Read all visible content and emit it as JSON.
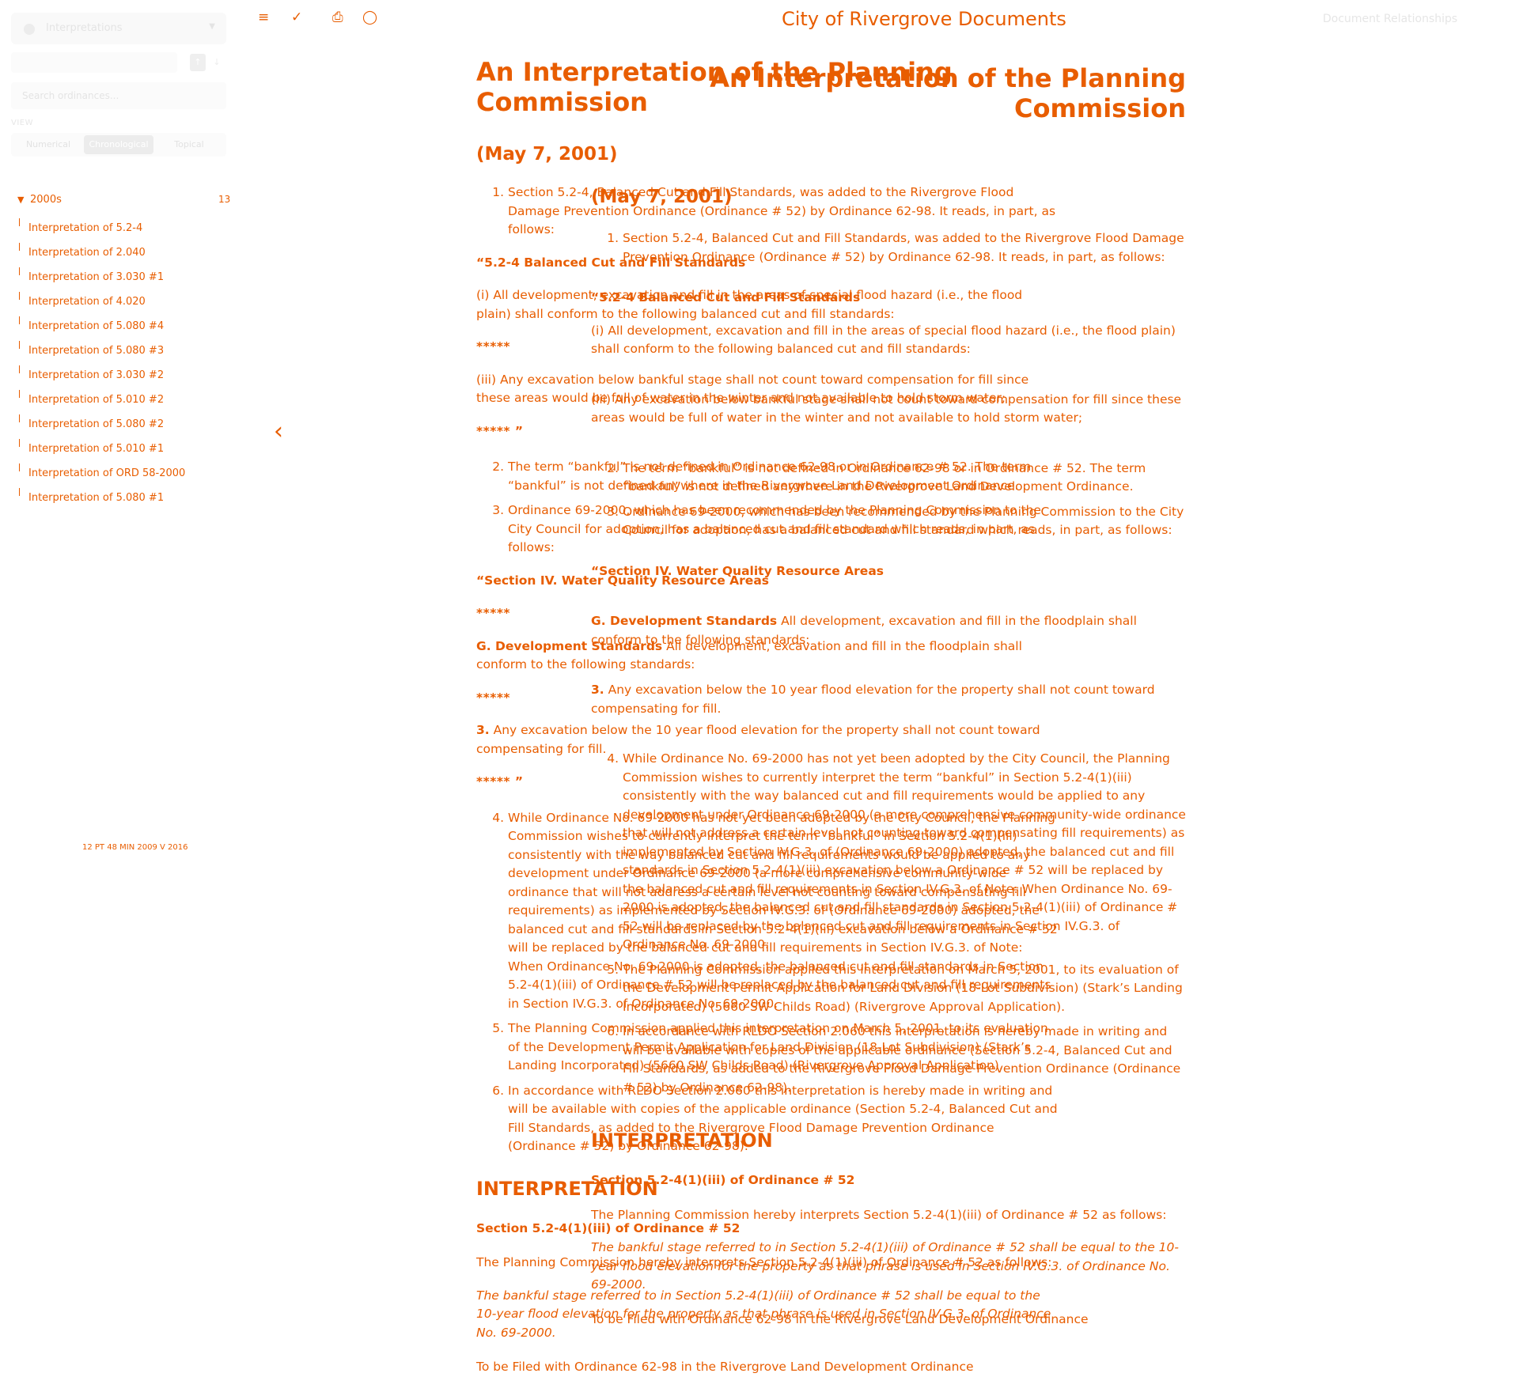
{
  "sidebar": {
    "dropdown_label": "Interpretations",
    "sort_label": "",
    "search_placeholder": "Search ordinances...",
    "view_label": "VIEW",
    "view_options": [
      "Numerical",
      "Chronological",
      "Topical"
    ],
    "active_view": "Chronological",
    "group": {
      "name": "2000s",
      "count": "13",
      "expanded": true
    },
    "items": [
      "Interpretation of 5.2-4",
      "Interpretation of 2.040",
      "Interpretation of 3.030 #1",
      "Interpretation of 4.020",
      "Interpretation of 5.080 #4",
      "Interpretation of 5.080 #3",
      "Interpretation of 3.030 #2",
      "Interpretation of 5.010 #2",
      "Interpretation of 5.080 #2",
      "Interpretation of 5.010 #1",
      "Interpretation of ORD 58-2000",
      "Interpretation of 5.080 #1"
    ],
    "footer_note": "12 PT 48 MIN 2009 V 2016"
  },
  "header": {
    "app_title": "City of Rivergrove Documents",
    "right_panel_title": "Document Relationships",
    "back_arrow": "‹"
  },
  "icons": {
    "list": "≡",
    "check": "✓",
    "print": "⎙",
    "github": "◯"
  },
  "colors": {
    "accent": "#e85d00"
  },
  "document": {
    "title": "An Interpretation of the Planning Commission",
    "date": "(May 7, 2001)",
    "items": [
      "Section 5.2-4, Balanced Cut and Fill Standards, was added to the Rivergrove Flood Damage Prevention Ordinance (Ordinance # 52) by Ordinance 62-98. It reads, in part, as follows:",
      "The term “bankful” is not defined in Ordinance 62-98 or in Ordinance # 52. The term “bankful” is not defined anywhere in the Rivergrove Land Development Ordinance.",
      "Ordinance 69-2000, which has been recommended by the Planning Commission to the City Council for adoption, has a balanced cut and fill standard which reads, in part, as follows:",
      "While Ordinance No. 69-2000 has not yet been adopted by the City Council, the Planning Commission wishes to currently interpret the term “bankful” in Section 5.2-4(1)(iii) consistently with the way balanced cut and fill requirements would be applied to any development under Ordinance 69-2000 (a more comprehensive community-wide ordinance that will not address a certain level not counting toward compensating fill requirements) as implemented by Section IV.G.3. of (Ordinance 69-2000) adopted, the balanced cut and fill standards in Section 5.2-4(1)(iii) excavation below a Ordinance # 52 will be replaced by the balanced cut and fill requirements in Section IV.G.3. of Note: When Ordinance No. 69-2000 is adopted, the balanced cut and fill standards in Section 5.2-4(1)(iii) of Ordinance # 52 will be replaced by the balanced cut and fill requirements in Section IV.G.3. of Ordinance No. 69-2000.",
      "The Planning Commission applied this interpretation on March 5, 2001, to its evaluation of the Development Permit Application for Land Division (18-Lot Subdivision) (Stark’s Landing Incorporated) (5660 SW Childs Road) (Rivergrove Approval Application).",
      "In accordance with RLDO Section 2.060 this interpretation is hereby made in writing and will be available with copies of the applicable ordinance (Section 5.2-4, Balanced Cut and Fill Standards, as added to the Rivergrove Flood Damage Prevention Ordinance (Ordinance # 52) by Ordinance 62-98)."
    ],
    "quote1_title": "“5.2-4 Balanced Cut and Fill Standards",
    "quote1_text1": "(i) All development, excavation and fill in the areas of special flood hazard (i.e., the flood plain) shall conform to the following balanced cut and fill standards:",
    "stars": "*****",
    "quote1_text2": "(iii) Any excavation below bankful stage shall not count toward compensation for fill since these areas would be full of water in the winter and not available to hold storm water;",
    "stars_quote": "***** ”",
    "quote2_title": "“Section IV. Water Quality Resource Areas",
    "quote2_g_bold": "G. Development Standards",
    "quote2_g_text": " All development, excavation and fill in the floodplain shall conform to the following standards:",
    "quote2_3_bold": "3.",
    "quote2_3_text": " Any excavation below the 10 year flood elevation for the property shall not count toward compensating for fill.",
    "interp_heading": "INTERPRETATION",
    "interp_section": "Section 5.2-4(1)(iii) of Ordinance # 52",
    "interp_intro": "The Planning Commission hereby interprets Section 5.2-4(1)(iii) of Ordinance # 52 as follows:",
    "interp_italic": "The bankful stage referred to in Section 5.2-4(1)(iii) of Ordinance # 52 shall be equal to the 10-year flood elevation for the property as that phrase is used in Section IV.G.3. of Ordinance No. 69-2000.",
    "filed": "To be Filed with Ordinance 62-98 in the Rivergrove Land Development Ordinance"
  }
}
